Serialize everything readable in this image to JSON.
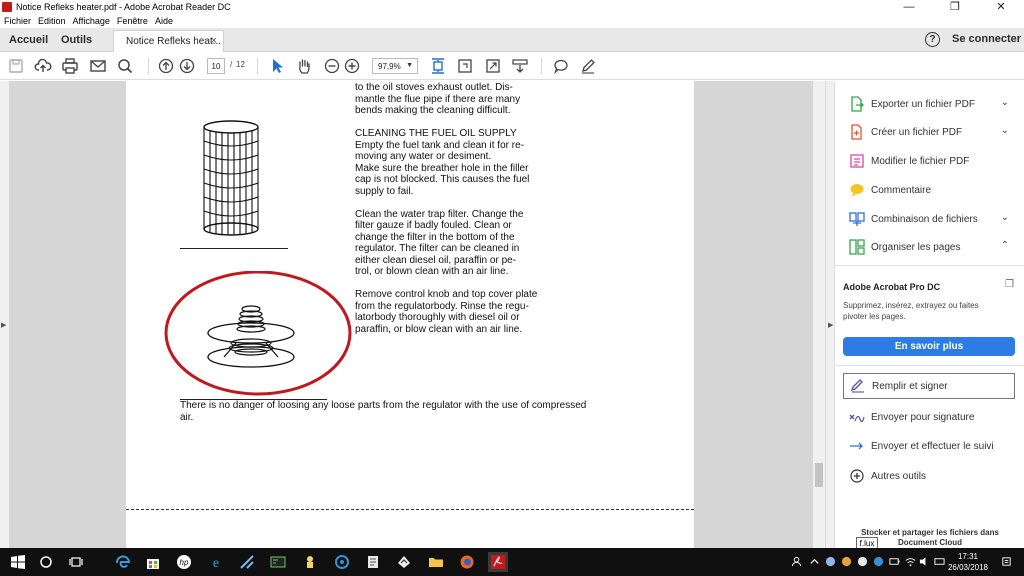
{
  "window": {
    "title": "Notice Refleks heater.pdf - Adobe Acrobat Reader DC",
    "minimize": "—",
    "maximize": "❐",
    "close": "✕"
  },
  "menu": [
    "Fichier",
    "Edition",
    "Affichage",
    "Fenêtre",
    "Aide"
  ],
  "tabs": {
    "home": "Accueil",
    "tools": "Outils",
    "document": "Notice Refleks heat...",
    "document_close": "×",
    "help": "?",
    "sign_in": "Se connecter"
  },
  "toolbar": {
    "current_page": "10",
    "page_separator": "/",
    "total_pages": "12",
    "zoom": "97,9%",
    "icons": [
      "save-icon",
      "upload-icon",
      "print-icon",
      "email-icon",
      "search-icon",
      "page-up-icon",
      "page-down-icon",
      "select-cursor-icon",
      "hand-icon",
      "zoom-out-icon",
      "zoom-in-icon",
      "fit-page-icon",
      "rotate-icon",
      "fullscreen-icon",
      "scroll-mode-icon",
      "comment-icon",
      "pen-icon"
    ]
  },
  "document": {
    "col1_line1": "to the oil stoves exhaust outlet. Dis-",
    "col1_line2": "mantle the flue pipe if there are many",
    "col1_line3": "bends making the cleaning difficult.",
    "heading": "CLEANING THE FUEL OIL SUPPLY",
    "para1": [
      "Empty the fuel tank and clean it for re-",
      "moving any water or desiment.",
      "Make sure the breather hole in the filler",
      "cap is not blocked. This causes the fuel",
      "supply to fail."
    ],
    "para2": [
      "Clean the water trap filter. Change the",
      "filter gauze if badly fouled. Clean or",
      "change the filter in the bottom of the",
      "regulator. The filter can be cleaned in",
      "either clean diesel oil, paraffin or pe-",
      "trol, or blown clean with an air line."
    ],
    "para3": [
      "Remove control knob and top cover plate",
      "from the regulatorbody. Rinse the regu-",
      "latorbody thoroughly with diesel oil or",
      "paraffin, or blow clean with an air line."
    ],
    "footer_line1": "There is no danger of loosing any loose parts from the regulator with the use of compressed",
    "footer_line2": "air.",
    "highlight_color": "#c0181c"
  },
  "right_pane": {
    "tools": [
      {
        "label": "Exporter un fichier PDF",
        "icon": "export-pdf-icon",
        "chevron": "⌄",
        "color": "#3aa34e"
      },
      {
        "label": "Créer un fichier PDF",
        "icon": "create-pdf-icon",
        "chevron": "⌄",
        "color": "#e0523f"
      },
      {
        "label": "Modifier le fichier PDF",
        "icon": "edit-pdf-icon",
        "chevron": "",
        "color": "#d948a8"
      },
      {
        "label": "Commentaire",
        "icon": "comment-icon",
        "chevron": "",
        "color": "#f0b400"
      },
      {
        "label": "Combinaison de fichiers",
        "icon": "combine-files-icon",
        "chevron": "⌄",
        "color": "#2f6fd6"
      },
      {
        "label": "Organiser les pages",
        "icon": "organize-pages-icon",
        "chevron": "⌃",
        "color": "#3aa34e"
      }
    ],
    "promo_title": "Adobe Acrobat Pro DC",
    "promo_desc": "Supprimez, insérez, extrayez ou faites pivoter les pages.",
    "promo_button": "En savoir plus",
    "fill_sign": "Remplir et signer",
    "send_signature": "Envoyer pour signature",
    "send_track": "Envoyer et effectuer le suivi",
    "more_tools": "Autres outils",
    "storage_line1": "Stocker et partager les fichiers dans",
    "storage_line2": "Document Cloud",
    "accent": "#2d7be5"
  },
  "tooltip": "f.lux",
  "taskbar": {
    "time": "17:31",
    "date": "26/03/2018",
    "apps": [
      "windows-start-icon",
      "search-icon",
      "task-view-icon",
      "edge-icon",
      "store-icon",
      "hp-icon",
      "ie-icon",
      "steam-icon",
      "terminal-icon",
      "chess-icon",
      "network-app-icon",
      "notepad-icon",
      "inkscape-icon",
      "file-explorer-icon",
      "firefox-icon",
      "acrobat-icon"
    ]
  }
}
